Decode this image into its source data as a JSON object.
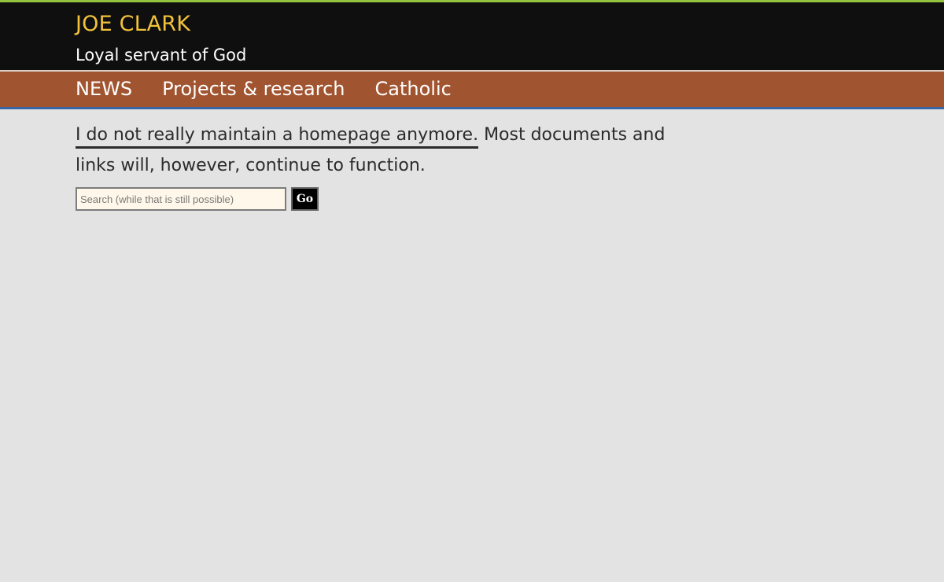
{
  "header": {
    "title": "JOE CLARK",
    "tagline": "Loyal servant of God"
  },
  "nav": {
    "items": [
      {
        "label": "NEWS"
      },
      {
        "label": "Projects & research"
      },
      {
        "label": "Catholic"
      }
    ]
  },
  "main": {
    "intro_link_text": "I do not really maintain a homepage anymore.",
    "intro_rest": " Most documents and links will, however, continue to function."
  },
  "search": {
    "placeholder": "Search (while that is still possible)",
    "button_label": "Go"
  },
  "colors": {
    "header_bg": "#0f0f0f",
    "title": "#f2c23b",
    "nav_bg": "#a15430",
    "nav_border": "#3b66a5",
    "top_bar": "#93c33e",
    "page_bg": "#e3e3e3"
  }
}
